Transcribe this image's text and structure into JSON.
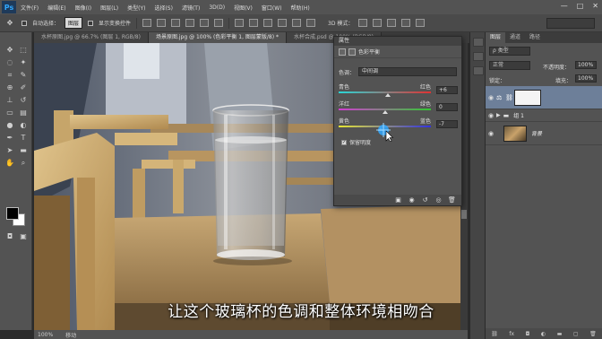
{
  "app": {
    "logo": "Ps"
  },
  "menu": {
    "items": [
      "文件(F)",
      "编辑(E)",
      "图像(I)",
      "图层(L)",
      "类型(Y)",
      "选择(S)",
      "滤镜(T)",
      "3D(D)",
      "视图(V)",
      "窗口(W)",
      "帮助(H)"
    ]
  },
  "window_controls": {
    "minimize": "—",
    "maximize": "□",
    "close": "✕"
  },
  "options": {
    "auto_select_label": "自动选择：",
    "auto_select_value": "图层",
    "show_transform_label": "显示变换控件",
    "mode_3d_label": "3D 模式："
  },
  "tabs": [
    "水杯原图.jpg @ 66.7% (图层 1, RGB/8)",
    "场景原图.jpg @ 100% (色彩平衡 1, 图层蒙版/8) *",
    "水杯合成.psd @ 100% (RGB/8)"
  ],
  "status": {
    "zoom": "100%",
    "info": "移动"
  },
  "properties": {
    "panel_title": "属性",
    "adjustment_title": "色彩平衡",
    "tone_label": "色调：",
    "tone_value": "中间调",
    "sliders": [
      {
        "left": "青色",
        "right": "红色",
        "value": "+6",
        "position": 0.53
      },
      {
        "left": "洋红",
        "right": "绿色",
        "value": "0",
        "position": 0.5
      },
      {
        "left": "黄色",
        "right": "蓝色",
        "value": "-7",
        "position": 0.46
      }
    ],
    "preserve_label": "保留明度",
    "preserve_checked": "✓"
  },
  "layers": {
    "tabs": [
      "图层",
      "通道",
      "路径"
    ],
    "filter_value": "ρ 类型",
    "blend_mode": "正常",
    "opacity_label": "不透明度：",
    "opacity_value": "100%",
    "lock_label": "锁定：",
    "fill_label": "填充：",
    "fill_value": "100%",
    "items": [
      {
        "name": "",
        "type": "adjustment",
        "selected": true
      },
      {
        "name": "组 1",
        "type": "group",
        "selected": false
      },
      {
        "name": "背景",
        "type": "image",
        "selected": false
      }
    ]
  },
  "subtitle": "让这个玻璃杯的色调和整体环境相吻合",
  "colors": {
    "accent": "#31a8ff",
    "selected_layer": "#6d7f99",
    "panel": "#535353"
  }
}
